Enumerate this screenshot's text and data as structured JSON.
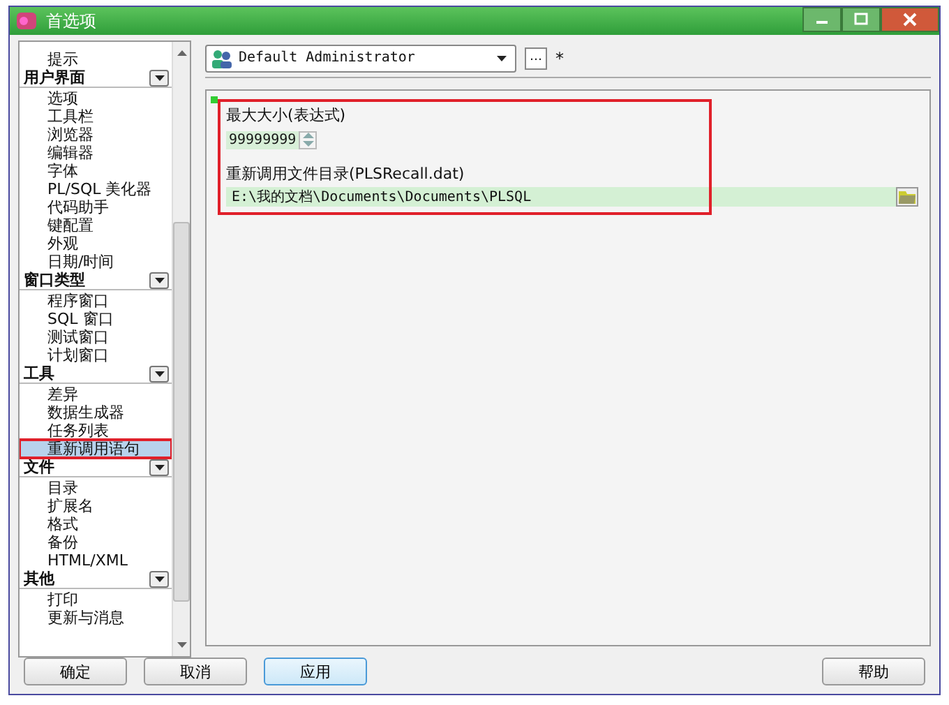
{
  "window": {
    "title": "首选项"
  },
  "sidebar": {
    "groups": [
      {
        "items": [
          {
            "label": "提示",
            "selected": false,
            "annotated": false
          }
        ]
      },
      {
        "title": "用户界面",
        "items": [
          {
            "label": "选项",
            "selected": false,
            "annotated": false
          },
          {
            "label": "工具栏",
            "selected": false,
            "annotated": false
          },
          {
            "label": "浏览器",
            "selected": false,
            "annotated": false
          },
          {
            "label": "编辑器",
            "selected": false,
            "annotated": false
          },
          {
            "label": "字体",
            "selected": false,
            "annotated": false
          },
          {
            "label": "PL/SQL 美化器",
            "selected": false,
            "annotated": false
          },
          {
            "label": "代码助手",
            "selected": false,
            "annotated": false
          },
          {
            "label": "键配置",
            "selected": false,
            "annotated": false
          },
          {
            "label": "外观",
            "selected": false,
            "annotated": false
          },
          {
            "label": "日期/时间",
            "selected": false,
            "annotated": false
          }
        ]
      },
      {
        "title": "窗口类型",
        "items": [
          {
            "label": "程序窗口",
            "selected": false,
            "annotated": false
          },
          {
            "label": "SQL 窗口",
            "selected": false,
            "annotated": false
          },
          {
            "label": "测试窗口",
            "selected": false,
            "annotated": false
          },
          {
            "label": "计划窗口",
            "selected": false,
            "annotated": false
          }
        ]
      },
      {
        "title": "工具",
        "items": [
          {
            "label": "差异",
            "selected": false,
            "annotated": false
          },
          {
            "label": "数据生成器",
            "selected": false,
            "annotated": false
          },
          {
            "label": "任务列表",
            "selected": false,
            "annotated": false
          },
          {
            "label": "重新调用语句",
            "selected": true,
            "annotated": true
          }
        ]
      },
      {
        "title": "文件",
        "items": [
          {
            "label": "目录",
            "selected": false,
            "annotated": false
          },
          {
            "label": "扩展名",
            "selected": false,
            "annotated": false
          },
          {
            "label": "格式",
            "selected": false,
            "annotated": false
          },
          {
            "label": "备份",
            "selected": false,
            "annotated": false
          },
          {
            "label": "HTML/XML",
            "selected": false,
            "annotated": false
          }
        ]
      },
      {
        "title": "其他",
        "items": [
          {
            "label": "打印",
            "selected": false,
            "annotated": false
          },
          {
            "label": "更新与消息",
            "selected": false,
            "annotated": false
          }
        ]
      }
    ]
  },
  "profile": {
    "value": "Default Administrator",
    "more": "…",
    "marker": "*"
  },
  "settings": {
    "annotated": true,
    "max_size": {
      "label": "最大大小(表达式)",
      "value": "99999999"
    },
    "recall_dir": {
      "label": "重新调用文件目录(PLSRecall.dat)",
      "value": "E:\\我的文档\\Documents\\Documents\\PLSQL"
    }
  },
  "buttons": [
    {
      "label": "确定",
      "selected": false
    },
    {
      "label": "取消",
      "selected": false
    },
    {
      "label": "应用",
      "selected": true
    },
    {
      "label": "帮助",
      "selected": false
    }
  ]
}
